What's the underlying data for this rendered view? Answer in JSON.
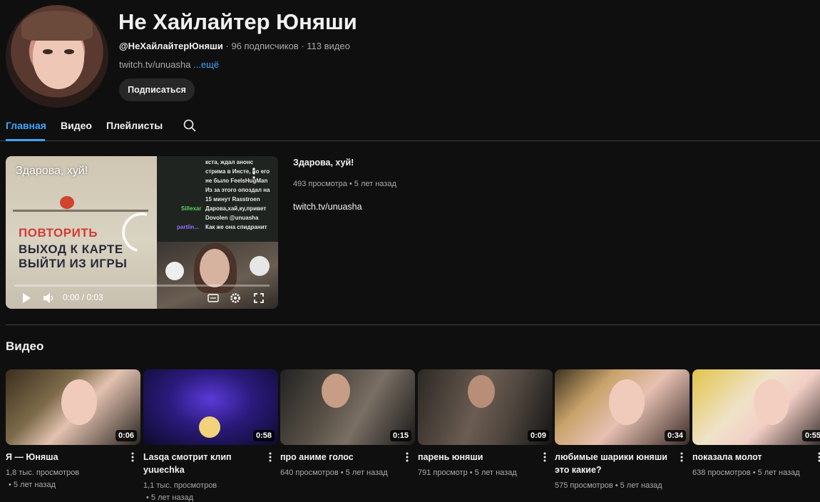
{
  "channel": {
    "name": "Не Хайлайтер Юняши",
    "handle": "@НеХайлайтерЮняши",
    "stats": " · 96 подписчиков · 113 видео",
    "link": "twitch.tv/unuasha",
    "more": "...ещё",
    "subscribe_label": "Подписаться"
  },
  "tabs": [
    {
      "label": "Главная",
      "active": true
    },
    {
      "label": "Видео",
      "active": false
    },
    {
      "label": "Плейлисты",
      "active": false
    }
  ],
  "featured": {
    "player_title": "Здарова, хуй!",
    "time": "0:00 / 0:03",
    "title": "Здарова, хуй!",
    "meta": "493 просмотра • 5 лет назад",
    "description": "twitch.tv/unuasha",
    "game_menu": [
      "ПОВТОРИТЬ",
      "ВЫХОД К КАРТЕ",
      "ВЫЙТИ ИЗ ИГРЫ"
    ],
    "chat": [
      "кста, ждал анонс",
      "стрима в Инсте, но его",
      "не было FeelsHugMan",
      "Из за этого опоздал на",
      "15 минут Rasstroen",
      "Дарова,хай,ку,привет",
      "Dovolen @unuasha",
      "Как же она спидранит"
    ],
    "chat_users": [
      "Sillexar",
      "partlin..."
    ]
  },
  "videos_section": {
    "title": "Видео",
    "items": [
      {
        "title": "Я — Юняша",
        "views": "1,8 тыс. просмотров",
        "age": "• 5 лет назад",
        "duration": "0:06"
      },
      {
        "title": "Lasqa смотрит клип yuuechka",
        "views": "1,1 тыс. просмотров",
        "age": "• 5 лет назад",
        "duration": "0:58"
      },
      {
        "title": "про аниме голос",
        "views": "640 просмотров • 5 лет назад",
        "age": "",
        "duration": "0:15"
      },
      {
        "title": "парень юняши",
        "views": "791 просмотр • 5 лет назад",
        "age": "",
        "duration": "0:09"
      },
      {
        "title": "любимые шарики юняши это какие?",
        "views": "575 просмотров • 5 лет назад",
        "age": "",
        "duration": "0:34"
      },
      {
        "title": "показала молот",
        "views": "638 просмотров • 5 лет назад",
        "age": "",
        "duration": "0:55"
      }
    ]
  },
  "colors": {
    "background": "#0f0f0f",
    "accent": "#3ea6ff",
    "text": "#f1f1f1",
    "secondary_text": "#aaaaaa"
  }
}
